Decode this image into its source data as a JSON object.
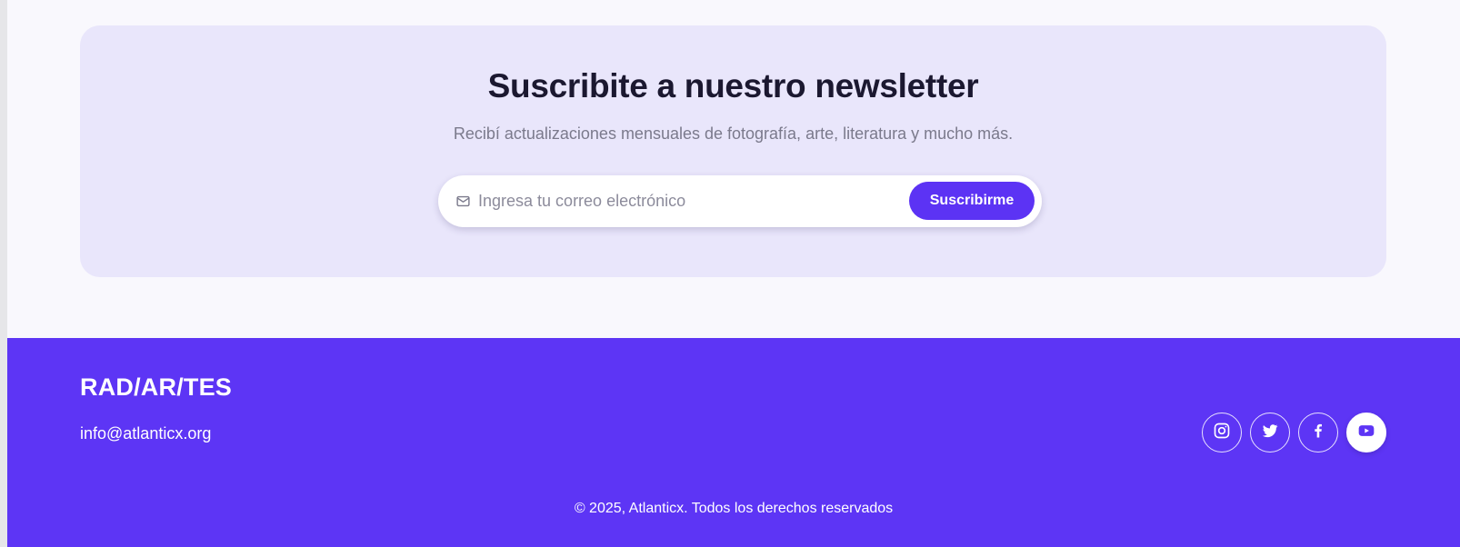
{
  "newsletter": {
    "title": "Suscribite a nuestro newsletter",
    "subtitle": "Recibí actualizaciones mensuales de fotografía, arte, literatura y mucho más.",
    "email_placeholder": "Ingresa tu correo electrónico",
    "email_value": "",
    "submit_label": "Suscribirme",
    "icon": "mail-icon"
  },
  "footer": {
    "brand": "RAD/AR/TES",
    "email": "info@atlanticx.org",
    "socials": [
      {
        "icon": "instagram-icon",
        "active": false
      },
      {
        "icon": "twitter-icon",
        "active": false
      },
      {
        "icon": "facebook-icon",
        "active": false
      },
      {
        "icon": "youtube-icon",
        "active": true
      }
    ],
    "copyright": "© 2025, Atlanticx. Todos los derechos reservados"
  },
  "colors": {
    "accent": "#5d35f5",
    "button": "#5c33f4",
    "newsletter_bg": "#e9e6fb",
    "page_bg": "#f9f8fd",
    "title": "#1b1830",
    "muted_text": "#7b7a8c"
  }
}
